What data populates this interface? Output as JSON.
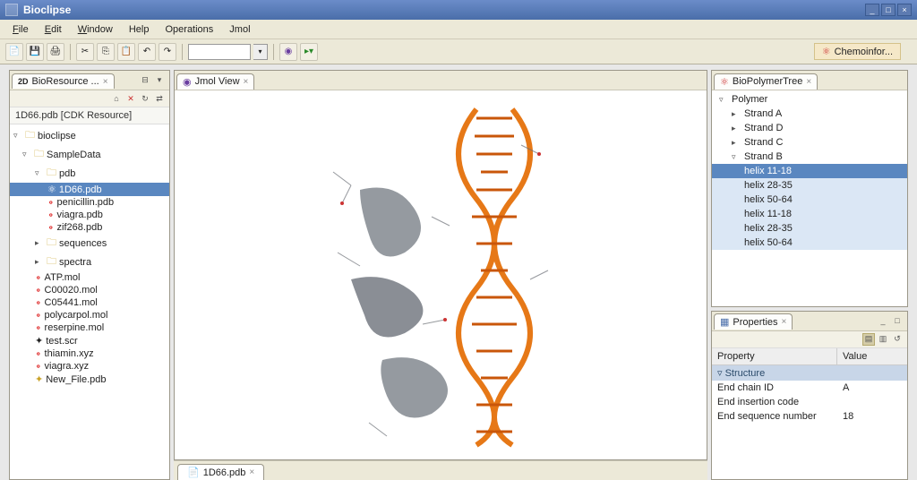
{
  "title": "Bioclipse",
  "menu": [
    "File",
    "Edit",
    "Window",
    "Help",
    "Operations",
    "Jmol"
  ],
  "perspective": "Chemoinfor...",
  "views": {
    "bioresource": {
      "tab": "BioResource ..."
    },
    "jmol": {
      "tab": "Jmol View"
    },
    "biopolymer": {
      "tab": "BioPolymerTree"
    },
    "properties": {
      "tab": "Properties"
    }
  },
  "tree_status": "1D66.pdb [CDK Resource]",
  "tree": {
    "root": "bioclipse",
    "sampleData": "SampleData",
    "pdb": {
      "name": "pdb",
      "items": [
        "1D66.pdb",
        "penicillin.pdb",
        "viagra.pdb",
        "zif268.pdb"
      ],
      "selected": "1D66.pdb"
    },
    "sequences": "sequences",
    "spectra": "spectra",
    "mols": [
      "ATP.mol",
      "C00020.mol",
      "C05441.mol",
      "polycarpol.mol",
      "reserpine.mol"
    ],
    "scr": "test.scr",
    "xyz": [
      "thiamin.xyz",
      "viagra.xyz"
    ],
    "new": "New_File.pdb"
  },
  "bottom_tab": "1D66.pdb",
  "biopolymer": {
    "root": "Polymer",
    "strands": [
      "Strand A",
      "Strand D",
      "Strand C",
      "Strand B"
    ],
    "helices_b": [
      "helix 11-18",
      "helix 28-35",
      "helix 50-64",
      "helix 11-18",
      "helix 28-35",
      "helix 50-64"
    ],
    "selected": "helix 11-18"
  },
  "properties": {
    "header": {
      "c1": "Property",
      "c2": "Value"
    },
    "category": "Structure",
    "rows": [
      {
        "p": "End chain ID",
        "v": "A"
      },
      {
        "p": "End insertion code",
        "v": ""
      },
      {
        "p": "End sequence number",
        "v": "18"
      }
    ]
  }
}
